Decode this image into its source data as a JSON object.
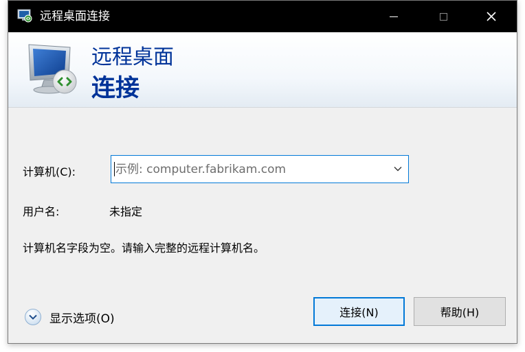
{
  "window": {
    "title": "远程桌面连接",
    "close_glyph": "✕"
  },
  "banner": {
    "title_line1": "远程桌面",
    "title_line2": "连接"
  },
  "form": {
    "computer_label": "计算机(C):",
    "computer_value": "",
    "computer_placeholder": "示例: computer.fabrikam.com",
    "username_label": "用户名:",
    "username_value": "未指定",
    "message": "计算机名字段为空。请输入完整的远程计算机名。"
  },
  "footer": {
    "show_options_label": "显示选项(O)",
    "connect_label": "连接(N)",
    "help_label": "帮助(H)"
  },
  "icons": {
    "title_icon": "remote-desktop-icon",
    "logo": "remote-desktop-monitor-icon",
    "dropdown": "chevron-down-icon",
    "options": "expand-circle-icon"
  },
  "colors": {
    "accent": "#0078d7",
    "banner_text": "#003399",
    "titlebar": "#000000"
  }
}
